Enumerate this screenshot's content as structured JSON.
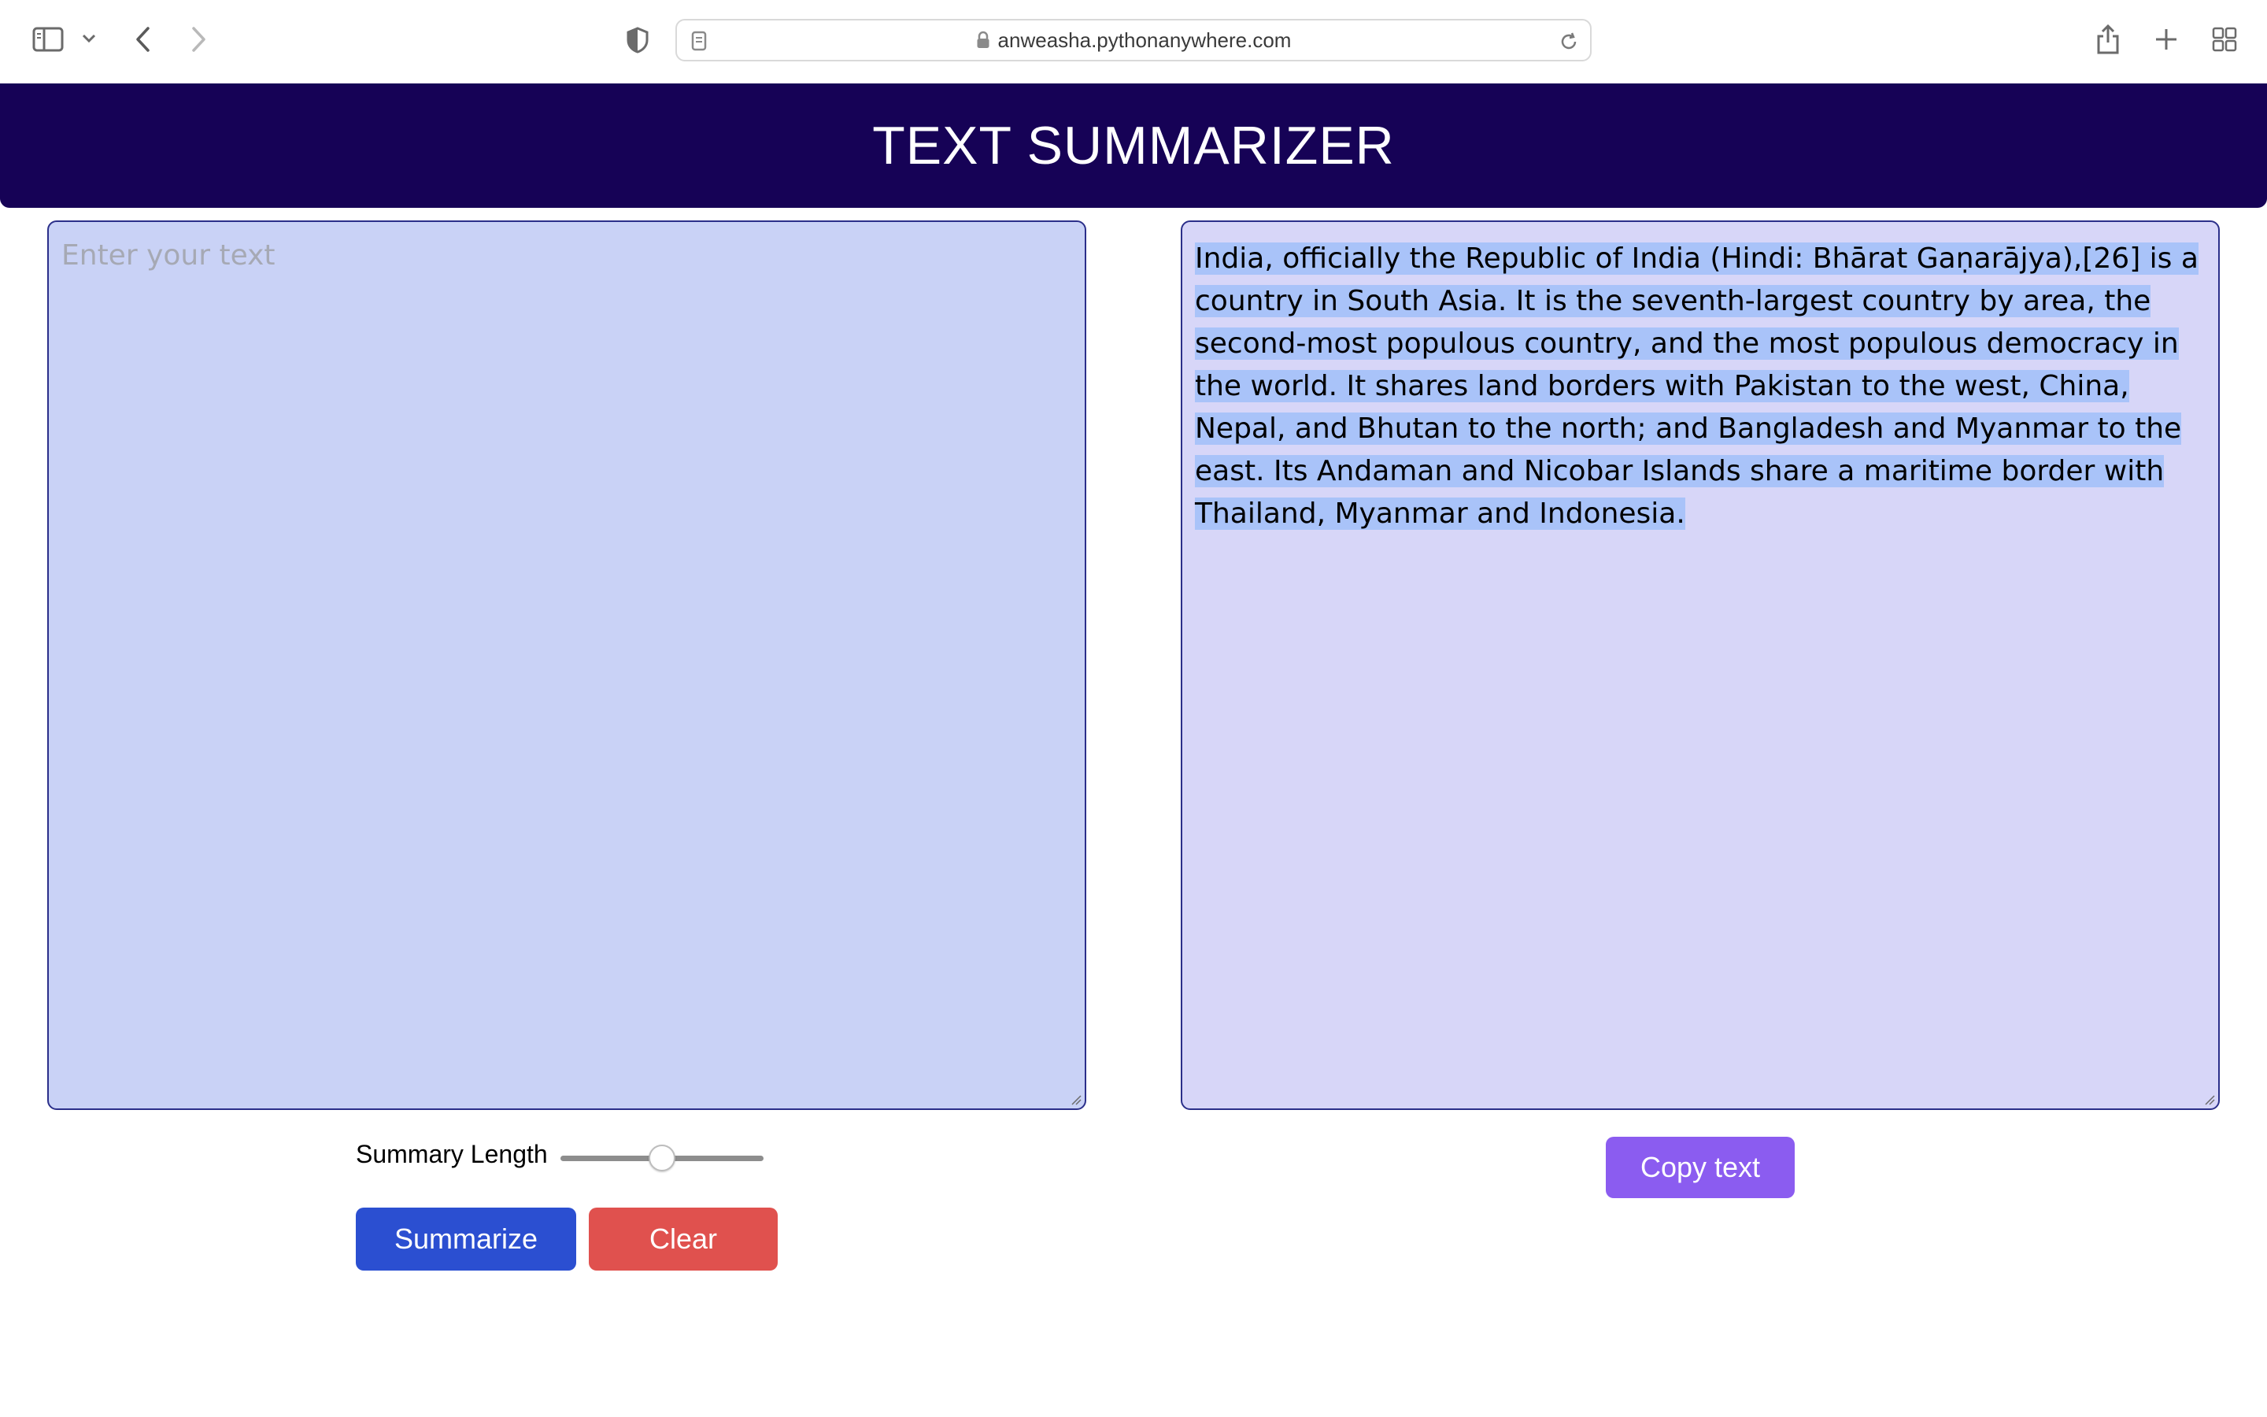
{
  "browser": {
    "url": "anweasha.pythonanywhere.com"
  },
  "header": {
    "title": "TEXT SUMMARIZER"
  },
  "input": {
    "placeholder": "Enter your text",
    "value": ""
  },
  "output": {
    "text": "India, officially the Republic of India (Hindi: Bhārat Gaṇarājya),[26] is a country in South Asia. It is the seventh-largest country by area, the second-most populous country, and the most populous democracy in the world. It shares land borders with Pakistan to the west, China, Nepal, and Bhutan to the north; and Bangladesh and Myanmar to the east. Its Andaman and Nicobar Islands share a maritime border with Thailand, Myanmar and Indonesia."
  },
  "controls": {
    "summary_length_label": "Summary Length",
    "summary_length_value": 0.5,
    "summarize_label": "Summarize",
    "clear_label": "Clear",
    "copy_label": "Copy text"
  },
  "colors": {
    "header_bg": "#160256",
    "input_bg": "#c9d2f6",
    "output_bg": "#d7d6f8",
    "summarize_btn": "#2b4fd1",
    "clear_btn": "#e0514e",
    "copy_btn": "#8b5cf0",
    "selection": "#a9c3f9"
  },
  "icons": {
    "sidebar": "sidebar-icon",
    "chevron": "chevron-down-icon",
    "back": "back-arrow-icon",
    "forward": "forward-arrow-icon",
    "privacy": "shield-icon",
    "page": "page-icon",
    "lock": "lock-icon",
    "reload": "reload-icon",
    "share": "share-icon",
    "new_tab": "plus-icon",
    "tabs": "tab-overview-icon"
  }
}
